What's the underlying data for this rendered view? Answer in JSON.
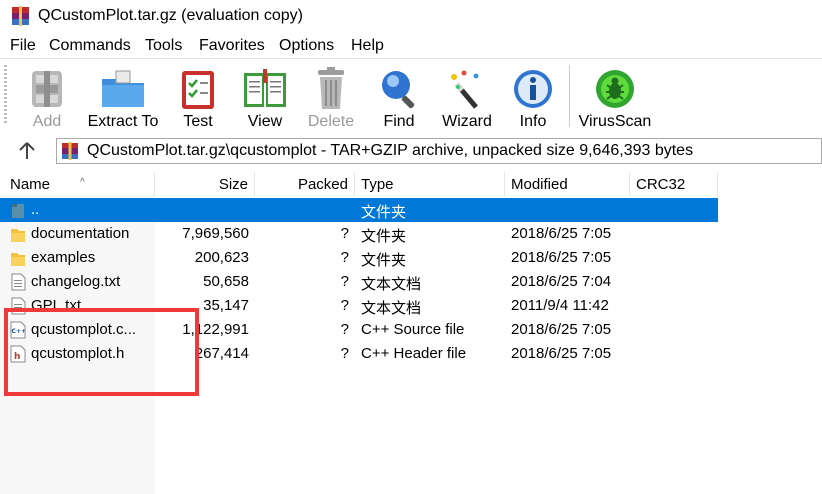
{
  "window": {
    "title": "QCustomPlot.tar.gz (evaluation copy)"
  },
  "menu": [
    "File",
    "Commands",
    "Tools",
    "Favorites",
    "Options",
    "Help"
  ],
  "toolbar": {
    "add": "Add",
    "extract": "Extract To",
    "test": "Test",
    "view": "View",
    "delete": "Delete",
    "find": "Find",
    "wizard": "Wizard",
    "info": "Info",
    "virusscan": "VirusScan"
  },
  "address": {
    "path": "QCustomPlot.tar.gz\\qcustomplot - TAR+GZIP archive, unpacked size 9,646,393 bytes"
  },
  "columns": {
    "name": "Name",
    "size": "Size",
    "packed": "Packed",
    "type": "Type",
    "modified": "Modified",
    "crc": "CRC32"
  },
  "files": [
    {
      "name": "..",
      "size": "",
      "packed": "",
      "type": "文件夹",
      "modified": "",
      "icon": "parent-folder-icon"
    },
    {
      "name": "documentation",
      "size": "7,969,560",
      "packed": "?",
      "type": "文件夹",
      "modified": "2018/6/25 7:05",
      "icon": "folder-icon"
    },
    {
      "name": "examples",
      "size": "200,623",
      "packed": "?",
      "type": "文件夹",
      "modified": "2018/6/25 7:05",
      "icon": "folder-icon"
    },
    {
      "name": "changelog.txt",
      "size": "50,658",
      "packed": "?",
      "type": "文本文档",
      "modified": "2018/6/25 7:04",
      "icon": "text-file-icon"
    },
    {
      "name": "GPL.txt",
      "size": "35,147",
      "packed": "?",
      "type": "文本文档",
      "modified": "2011/9/4 11:42",
      "icon": "text-file-icon"
    },
    {
      "name": "qcustomplot.c...",
      "size": "1,122,991",
      "packed": "?",
      "type": "C++ Source file",
      "modified": "2018/6/25 7:05",
      "icon": "cpp-file-icon"
    },
    {
      "name": "qcustomplot.h",
      "size": "267,414",
      "packed": "?",
      "type": "C++ Header file",
      "modified": "2018/6/25 7:05",
      "icon": "header-file-icon"
    }
  ],
  "annotation": {
    "color": "#ee3a3a"
  }
}
